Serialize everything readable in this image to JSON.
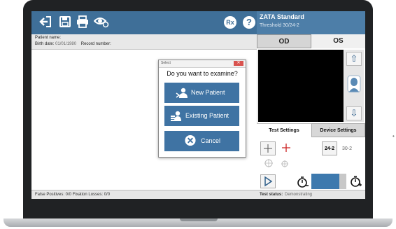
{
  "app": {
    "toolbar_icons": [
      "exit-icon",
      "save-icon",
      "print-icon",
      "view-icon",
      "rx-icon",
      "help-icon"
    ],
    "rx_label": "Rx",
    "help_label": "?"
  },
  "header": {
    "title": "ZATA Standard",
    "subtitle": "Threshold 30/24-2"
  },
  "patient": {
    "name_label": "Patient name:",
    "birth_label": "Birth date:",
    "birth_value": "01/01/1980",
    "record_label": "Record number:"
  },
  "eyes": {
    "od": "OD",
    "os": "OS"
  },
  "settings": {
    "tab_test": "Test Settings",
    "tab_device": "Device Settings",
    "pattern_active": "24-2",
    "pattern_alt": "30-2"
  },
  "dialog": {
    "title": "Select",
    "question": "Do you want to examine?",
    "new_patient": "New Patient",
    "existing_patient": "Existing Patient",
    "cancel": "Cancel"
  },
  "status": {
    "left": "False Positives: 0/0   Fixation Losses: 0/0",
    "right_label": "Test status:",
    "right_value": "Demonstrating"
  },
  "colors": {
    "toolbar": "#3f6f98",
    "dialog_button": "#3f73a3",
    "red_cross": "#cc2222"
  }
}
